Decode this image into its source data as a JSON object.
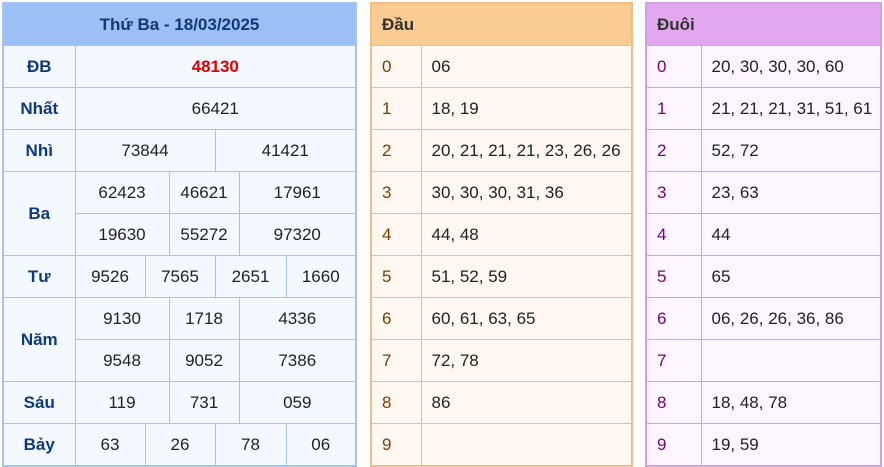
{
  "results": {
    "title": "Thứ Ba - 18/03/2025",
    "db": {
      "label": "ĐB",
      "values": [
        "48130"
      ]
    },
    "nhat": {
      "label": "Nhất",
      "values": [
        "66421"
      ]
    },
    "nhi": {
      "label": "Nhì",
      "values": [
        "73844",
        "41421"
      ]
    },
    "ba": {
      "label": "Ba",
      "values": [
        "62423",
        "46621",
        "17961",
        "19630",
        "55272",
        "97320"
      ]
    },
    "tu": {
      "label": "Tư",
      "values": [
        "9526",
        "7565",
        "2651",
        "1660"
      ]
    },
    "nam": {
      "label": "Năm",
      "values": [
        "9130",
        "1718",
        "4336",
        "9548",
        "9052",
        "7386"
      ]
    },
    "sau": {
      "label": "Sáu",
      "values": [
        "119",
        "731",
        "059"
      ]
    },
    "bay": {
      "label": "Bảy",
      "values": [
        "63",
        "26",
        "78",
        "06"
      ]
    },
    "special_color": "#e00000"
  },
  "heads": {
    "header": "Đầu",
    "rows": [
      {
        "digit": "0",
        "nums": "06"
      },
      {
        "digit": "1",
        "nums": "18, 19"
      },
      {
        "digit": "2",
        "nums": "20, 21, 21, 21, 23, 26, 26"
      },
      {
        "digit": "3",
        "nums": "30, 30, 30, 31, 36"
      },
      {
        "digit": "4",
        "nums": "44, 48"
      },
      {
        "digit": "5",
        "nums": "51, 52, 59"
      },
      {
        "digit": "6",
        "nums": "60, 61, 63, 65"
      },
      {
        "digit": "7",
        "nums": "72, 78"
      },
      {
        "digit": "8",
        "nums": "86"
      },
      {
        "digit": "9",
        "nums": ""
      }
    ]
  },
  "tails": {
    "header": "Đuôi",
    "rows": [
      {
        "digit": "0",
        "nums": "20, 30, 30, 30, 60"
      },
      {
        "digit": "1",
        "nums": "21, 21, 21, 31, 51, 61"
      },
      {
        "digit": "2",
        "nums": "52, 72"
      },
      {
        "digit": "3",
        "nums": "23, 63"
      },
      {
        "digit": "4",
        "nums": "44"
      },
      {
        "digit": "5",
        "nums": "65"
      },
      {
        "digit": "6",
        "nums": "06, 26, 26, 36, 86"
      },
      {
        "digit": "7",
        "nums": ""
      },
      {
        "digit": "8",
        "nums": "18, 48, 78"
      },
      {
        "digit": "9",
        "nums": "19, 59"
      }
    ]
  }
}
